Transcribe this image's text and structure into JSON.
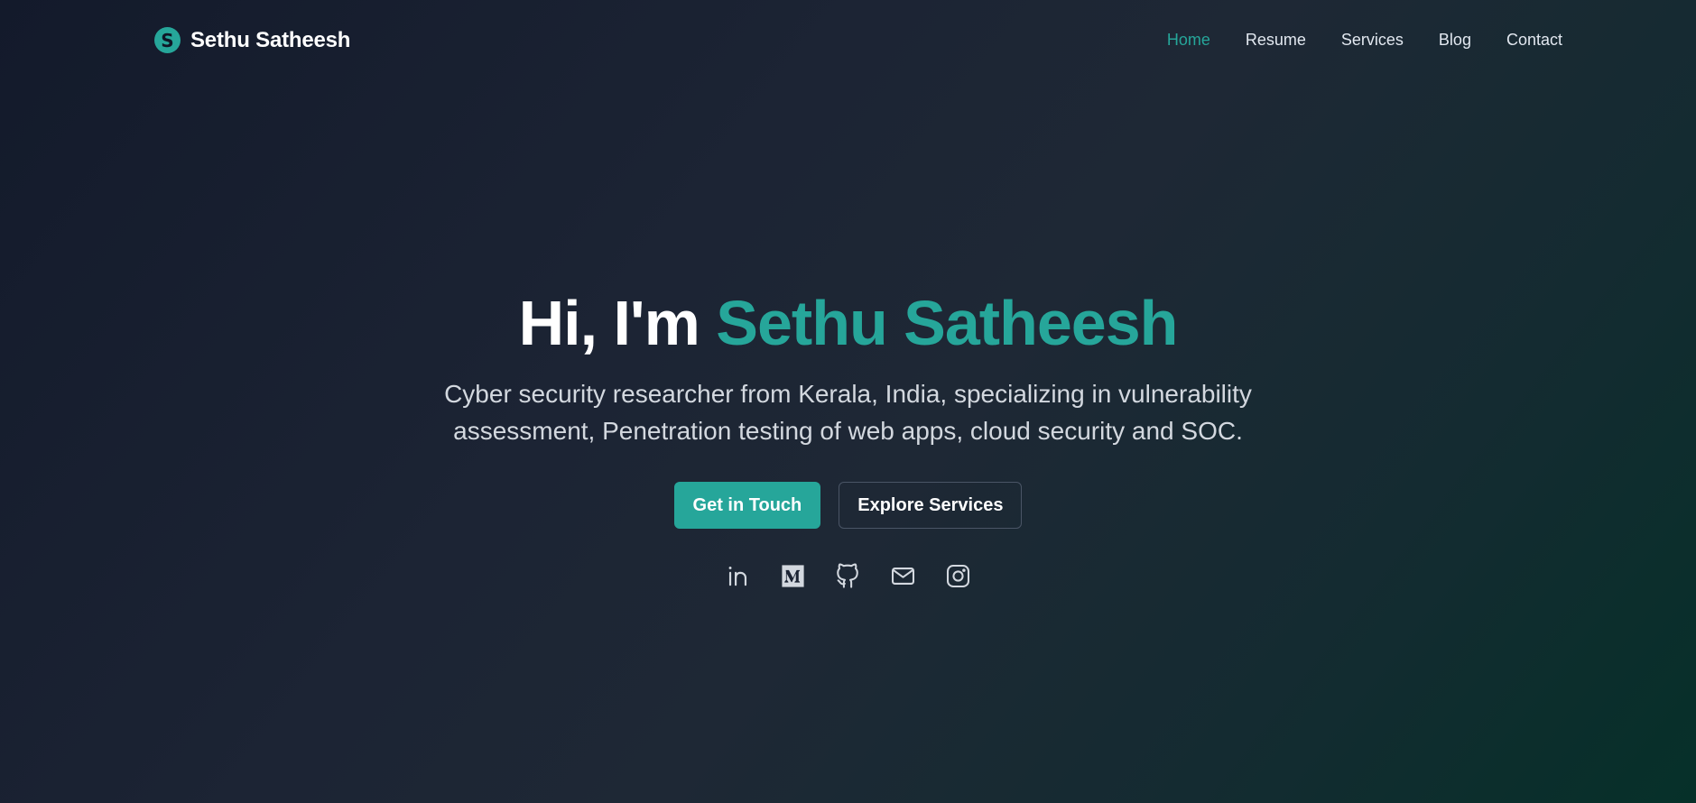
{
  "brand": {
    "initial": "S",
    "name": "Sethu Satheesh"
  },
  "nav": {
    "items": [
      {
        "label": "Home",
        "active": true
      },
      {
        "label": "Resume",
        "active": false
      },
      {
        "label": "Services",
        "active": false
      },
      {
        "label": "Blog",
        "active": false
      },
      {
        "label": "Contact",
        "active": false
      }
    ]
  },
  "hero": {
    "greeting": "Hi, I'm ",
    "name": "Sethu Satheesh",
    "description": "Cyber security researcher from Kerala, India, specializing in vulnerability assessment, Penetration testing of web apps, cloud security and SOC.",
    "primary_button": "Get in Touch",
    "secondary_button": "Explore Services"
  },
  "social": {
    "icons": [
      "linkedin-icon",
      "medium-icon",
      "github-icon",
      "mail-icon",
      "instagram-icon"
    ]
  },
  "colors": {
    "accent": "#26a69a",
    "background_start": "#131a2b",
    "background_end": "#063029",
    "text_muted": "#d3d8df"
  }
}
